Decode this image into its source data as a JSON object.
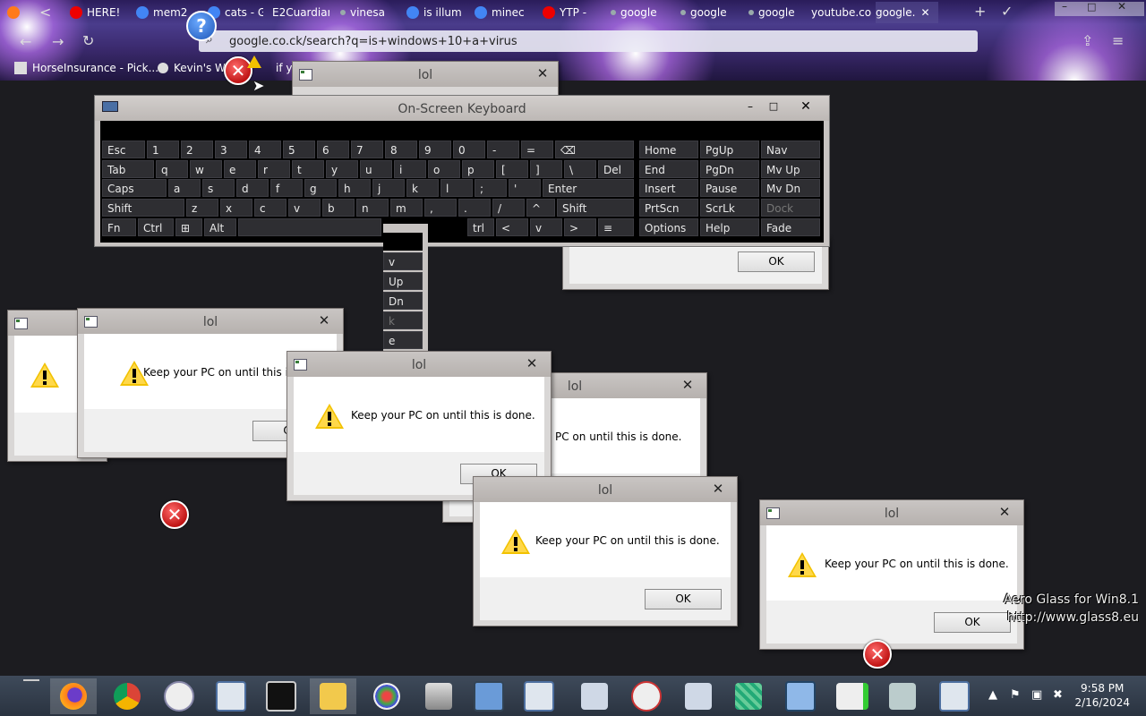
{
  "browser": {
    "tabs": [
      "HERE!",
      "mem2",
      "cats - G",
      "E2Cuardian",
      "vinesa",
      "is illum",
      "minec",
      "YTP -",
      "google",
      "google",
      "google",
      "youtube.co",
      "google."
    ],
    "url": "google.co.ck/search?q=is+windows+10+a+virus",
    "bookmarks": [
      "HorseInsurance - Pick...",
      "Kevin's WE",
      "if yo"
    ]
  },
  "osk": {
    "title": "On-Screen Keyboard",
    "rows": [
      [
        "Esc",
        "1",
        "2",
        "3",
        "4",
        "5",
        "6",
        "7",
        "8",
        "9",
        "0",
        "-",
        "=",
        "⌫"
      ],
      [
        "Tab",
        "q",
        "w",
        "e",
        "r",
        "t",
        "y",
        "u",
        "i",
        "o",
        "p",
        "[",
        "]",
        "\\",
        "Del"
      ],
      [
        "Caps",
        "a",
        "s",
        "d",
        "f",
        "g",
        "h",
        "j",
        "k",
        "l",
        ";",
        "'",
        "Enter"
      ],
      [
        "Shift",
        "z",
        "x",
        "c",
        "v",
        "b",
        "n",
        "m",
        ",",
        ".",
        "/",
        "^",
        "Shift"
      ],
      [
        "Fn",
        "Ctrl",
        "⊞",
        "Alt",
        "",
        "trl",
        "<",
        "v",
        ">",
        "≡"
      ]
    ],
    "nav": [
      [
        "Home",
        "PgUp",
        "Nav"
      ],
      [
        "End",
        "PgDn",
        "Mv Up"
      ],
      [
        "Insert",
        "Pause",
        "Mv Dn"
      ],
      [
        "PrtScn",
        "ScrLk",
        "Dock"
      ],
      [
        "Options",
        "Help",
        "Fade"
      ]
    ]
  },
  "dialogs": {
    "title": "lol",
    "message": "Keep your PC on until this is done.",
    "message_cut": "Keep your PC on until this is don",
    "message_cut2": "PC on until this is done.",
    "ok": "OK"
  },
  "side_strip": [
    "v",
    "Up",
    "Dn",
    "k",
    "e"
  ],
  "taskbar": {
    "time": "9:58 PM",
    "date": "2/16/2024"
  },
  "aero": {
    "line1": "Aero Glass for Win8.1",
    "line2": "http://www.glass8.eu"
  }
}
